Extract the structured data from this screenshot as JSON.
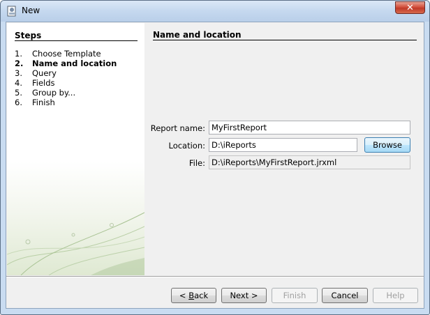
{
  "window": {
    "title": "New",
    "close_glyph": "✕",
    "app_icon": "report-wizard-icon"
  },
  "steps": {
    "title": "Steps",
    "items": [
      {
        "num": "1.",
        "label": "Choose Template"
      },
      {
        "num": "2.",
        "label": "Name and location"
      },
      {
        "num": "3.",
        "label": "Query"
      },
      {
        "num": "4.",
        "label": "Fields"
      },
      {
        "num": "5.",
        "label": "Group by..."
      },
      {
        "num": "6.",
        "label": "Finish"
      }
    ],
    "active_index": 1
  },
  "content": {
    "title": "Name and location",
    "report_name_label": "Report name:",
    "report_name_value": "MyFirstReport",
    "location_label": "Location:",
    "location_value": "D:\\iReports",
    "browse_label": "Browse",
    "file_label": "File:",
    "file_value": "D:\\iReports\\MyFirstReport.jrxml"
  },
  "buttons": {
    "back_pre": "< ",
    "back_mnemonic": "B",
    "back_post": "ack",
    "next_label": "Next >",
    "finish_label": "Finish",
    "cancel_label": "Cancel",
    "help_label": "Help"
  },
  "colors": {
    "title_bar": "#c5d8ef",
    "close_button": "#c03a28",
    "panel_background": "#f0f0f0",
    "steps_gradient_end": "#dfe9d2"
  }
}
